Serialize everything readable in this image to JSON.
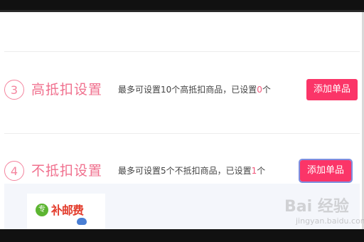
{
  "sections": [
    {
      "step_number": "3",
      "title": "高抵扣设置",
      "desc_prefix": "最多可设置10个高抵扣商品，已设置",
      "desc_count": "0",
      "desc_suffix": "个",
      "button_label": "添加单品"
    },
    {
      "step_number": "4",
      "title": "不抵扣设置",
      "desc_prefix": "最多可设置5个不抵扣商品，已设置",
      "desc_count": "1",
      "desc_suffix": "个",
      "button_label": "添加单品"
    }
  ],
  "product": {
    "badge": "专",
    "text": "补邮费"
  },
  "watermark": {
    "main": "Bai 经验",
    "sub": "jingyan.baidu.com"
  },
  "colors": {
    "accent": "#fb3568",
    "title_pink": "#f0708e",
    "count_highlight": "#f0567a"
  }
}
